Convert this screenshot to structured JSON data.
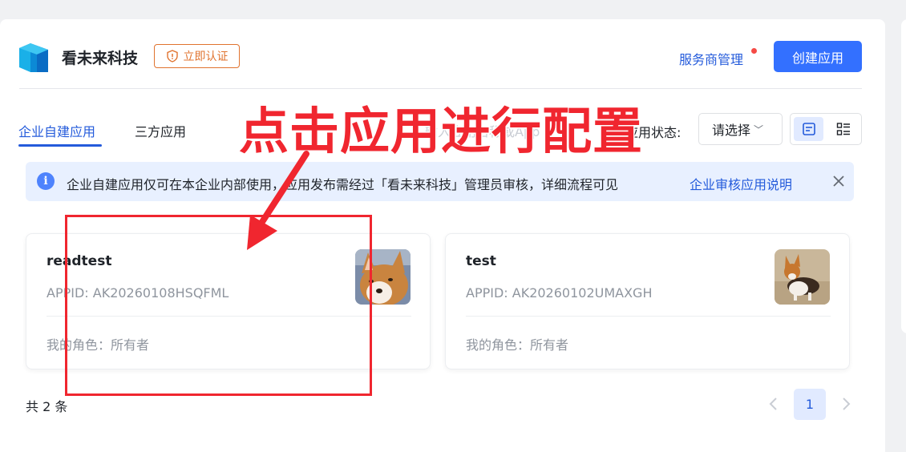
{
  "header": {
    "company_name": "看未来科技",
    "cert_label": "立即认证",
    "service_manager": "服务商管理",
    "create_app": "创建应用"
  },
  "tabs": [
    {
      "label": "企业自建应用",
      "active": true
    },
    {
      "label": "三方应用",
      "active": false
    }
  ],
  "search": {
    "placeholder_fragment": "输入应用名称或App"
  },
  "filter": {
    "status_label": "应用状态:",
    "select_value": "请选择"
  },
  "notice": {
    "text": "企业自建应用仅可在本企业内部使用，应用发布需经过「看未来科技」管理员审核，详细流程可见",
    "link": "企业审核应用说明"
  },
  "apps": [
    {
      "name": "readtest",
      "appid": "APPID: AK20260108HSQFML",
      "role": "我的角色：所有者",
      "avatar": "corgi-face-icon"
    },
    {
      "name": "test",
      "appid": "APPID: AK20260102UMAXGH",
      "role": "我的角色：所有者",
      "avatar": "corgi-standing-icon"
    }
  ],
  "annotation": {
    "text": "点击应用进行配置",
    "color": "#f0262f"
  },
  "pagination": {
    "total": "共 2 条",
    "current_page": "1"
  },
  "colors": {
    "primary": "#3370ff",
    "link": "#245bdb",
    "warning": "#e0732f",
    "notice_bg": "#e8f0ff"
  }
}
